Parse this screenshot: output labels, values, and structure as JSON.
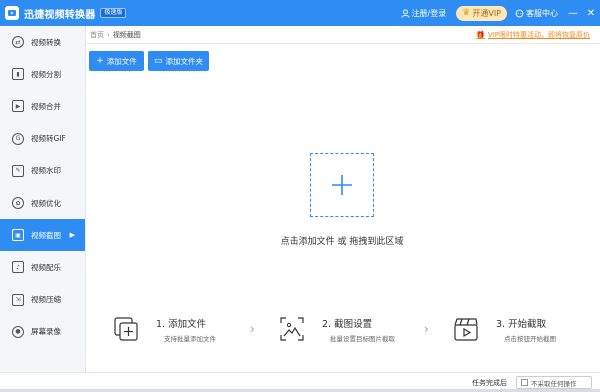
{
  "titlebar": {
    "app_title": "迅捷视频转换器",
    "badge": "极速版",
    "login": "注册/登录",
    "vip": "开通VIP",
    "service": "客服中心",
    "minimize": "—",
    "close": "✕"
  },
  "sidebar": {
    "items": [
      {
        "label": "视频转换",
        "icon": "convert-icon"
      },
      {
        "label": "视频分割",
        "icon": "split-icon"
      },
      {
        "label": "视频合并",
        "icon": "merge-icon"
      },
      {
        "label": "视频转GIF",
        "icon": "gif-icon"
      },
      {
        "label": "视频水印",
        "icon": "watermark-icon"
      },
      {
        "label": "视频优化",
        "icon": "optimize-icon"
      },
      {
        "label": "视频截图",
        "icon": "screenshot-icon",
        "active": true
      },
      {
        "label": "视频配乐",
        "icon": "music-icon"
      },
      {
        "label": "视频压缩",
        "icon": "compress-icon"
      },
      {
        "label": "屏幕录像",
        "icon": "record-icon"
      }
    ]
  },
  "breadcrumb": {
    "home": "首页",
    "separator": "›",
    "current": "视频截图"
  },
  "promo": "VIP限时特惠活动，即将恢复原价",
  "toolbar": {
    "add_file": "添加文件",
    "add_folder": "添加文件夹"
  },
  "drop_zone": {
    "text": "点击添加文件 或 拖拽到此区域"
  },
  "steps": [
    {
      "title": "1. 添加文件",
      "desc": "支持批量添加文件"
    },
    {
      "title": "2. 截图设置",
      "desc": "批量设置目标图片截取"
    },
    {
      "title": "3. 开始截取",
      "desc": "点击按钮开始截图"
    }
  ],
  "step_separator": "›",
  "statusbar": {
    "label": "任务完成后",
    "select_value": "不采取任何操作"
  },
  "colors": {
    "accent": "#2f8cf3",
    "promo": "#f08a24",
    "vip_bg": "#ffe7b8"
  }
}
